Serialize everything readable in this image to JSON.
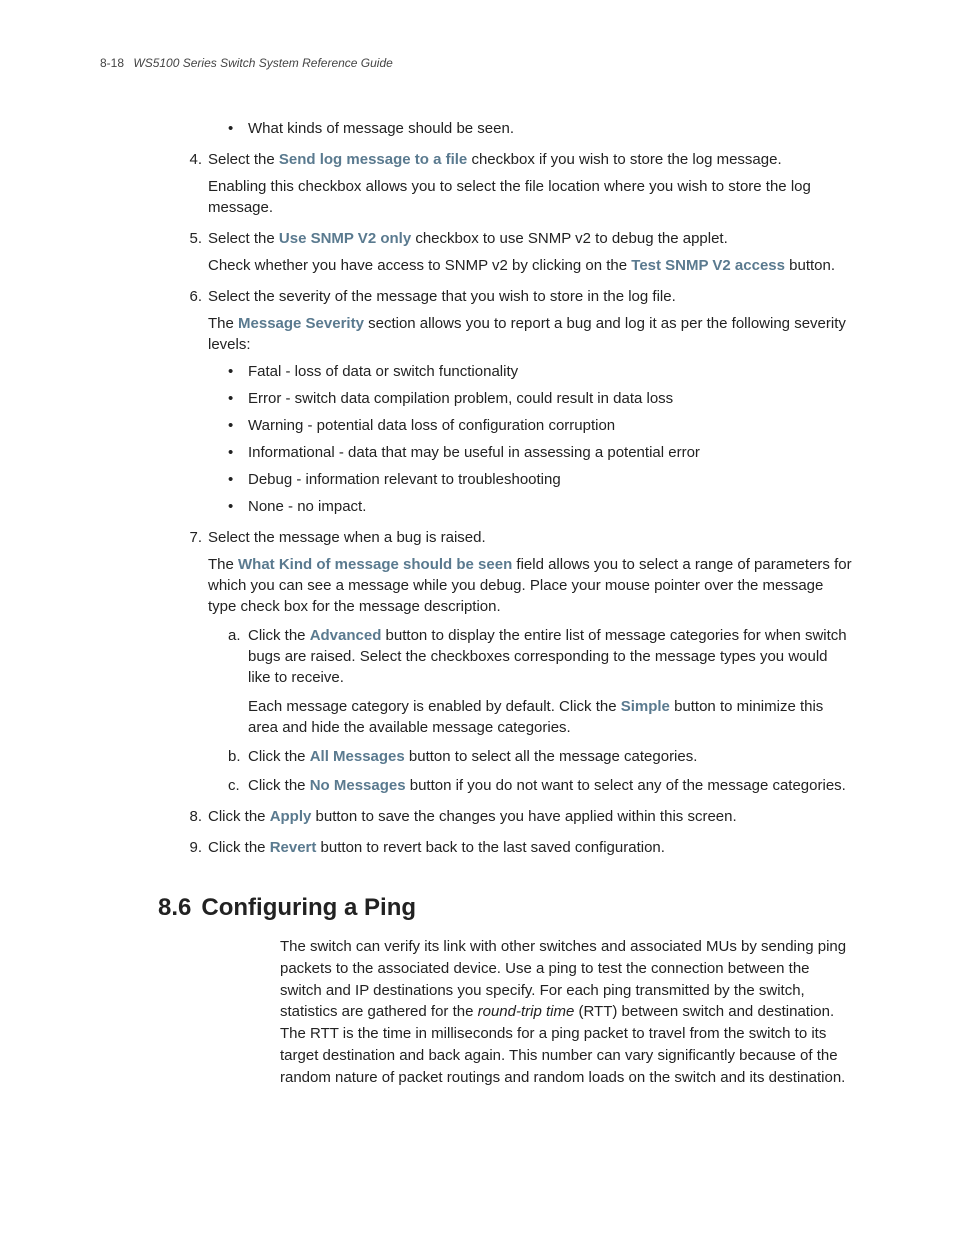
{
  "header": {
    "pageno": "8-18",
    "guide": "WS5100 Series Switch System Reference Guide"
  },
  "top_bullet": "What kinds of message should be seen.",
  "steps": {
    "s4": {
      "num": "4.",
      "pre": "Select the ",
      "bold": "Send log message to a file",
      "post": " checkbox if you wish to store the log message.",
      "cont": "Enabling this checkbox allows you to select the file location where you wish to store the log message."
    },
    "s5": {
      "num": "5.",
      "pre": "Select the ",
      "bold": "Use SNMP V2 only",
      "post": " checkbox to use SNMP v2 to debug the applet.",
      "cont_pre": "Check whether you have access to SNMP v2 by clicking on the ",
      "cont_bold": "Test SNMP V2 access",
      "cont_post": " button."
    },
    "s6": {
      "num": "6.",
      "line": "Select the severity of the message that you wish to store in the log file.",
      "cont_pre": "The ",
      "cont_bold": "Message Severity",
      "cont_post": " section allows you to report a bug and log it as per the following severity levels:",
      "bullets": [
        "Fatal - loss of data or switch functionality",
        "Error - switch data compilation problem, could result in data loss",
        "Warning - potential data loss of configuration corruption",
        "Informational - data that may be useful in assessing a potential error",
        "Debug - information relevant to troubleshooting",
        "None - no impact."
      ]
    },
    "s7": {
      "num": "7.",
      "line": "Select the message when a bug is raised.",
      "cont_pre": "The ",
      "cont_bold": "What Kind of message should be seen",
      "cont_post": " field allows you to select a range of parameters for which you can see a message while you debug. Place your mouse pointer over the message type check box for the message description.",
      "subs": {
        "a": {
          "label": "a.",
          "pre": "Click the ",
          "bold": "Advanced",
          "post": " button to display the entire list of message categories for when switch bugs are raised. Select the checkboxes corresponding to the message types you would like to receive.",
          "cont_pre": "Each message category is enabled by default. Click the ",
          "cont_bold": "Simple",
          "cont_post": " button to minimize this area and hide the available message categories."
        },
        "b": {
          "label": "b.",
          "pre": "Click the ",
          "bold": "All Messages",
          "post": " button to select all the message categories."
        },
        "c": {
          "label": "c.",
          "pre": "Click the ",
          "bold": "No Messages",
          "post": " button if you do not want to select any of the message categories."
        }
      }
    },
    "s8": {
      "num": "8.",
      "pre": "Click the ",
      "bold": "Apply",
      "post": " button to save the changes you have applied within this screen."
    },
    "s9": {
      "num": "9.",
      "pre": "Click the ",
      "bold": "Revert",
      "post": " button to revert back to the last saved configuration."
    }
  },
  "section": {
    "num": "8.6",
    "title": "Configuring a Ping",
    "body_pre": "The switch can verify its link with other switches and associated MUs by sending ping packets to the associated device. Use a ping to test the connection between the switch and IP destinations you specify. For each ping transmitted by the switch, statistics are gathered for the ",
    "body_ital": "round-trip time",
    "body_post": " (RTT) between switch and destination. The RTT is the time in milliseconds for a ping packet to travel from the switch to its target destination and back again. This number can vary significantly because of the random nature of packet routings and random loads on the switch and its destination."
  }
}
